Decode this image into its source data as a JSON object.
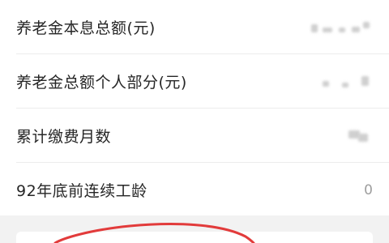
{
  "rows": [
    {
      "label": "养老金本息总额(元)",
      "value": ""
    },
    {
      "label": "养老金总额个人部分(元)",
      "value": ""
    },
    {
      "label": "累计缴费月数",
      "value": ""
    },
    {
      "label": "92年底前连续工龄",
      "value": "0"
    }
  ],
  "colors": {
    "annotation_circle": "#e23b3b",
    "divider": "#ececec",
    "footer_background": "#f2f2f2"
  }
}
